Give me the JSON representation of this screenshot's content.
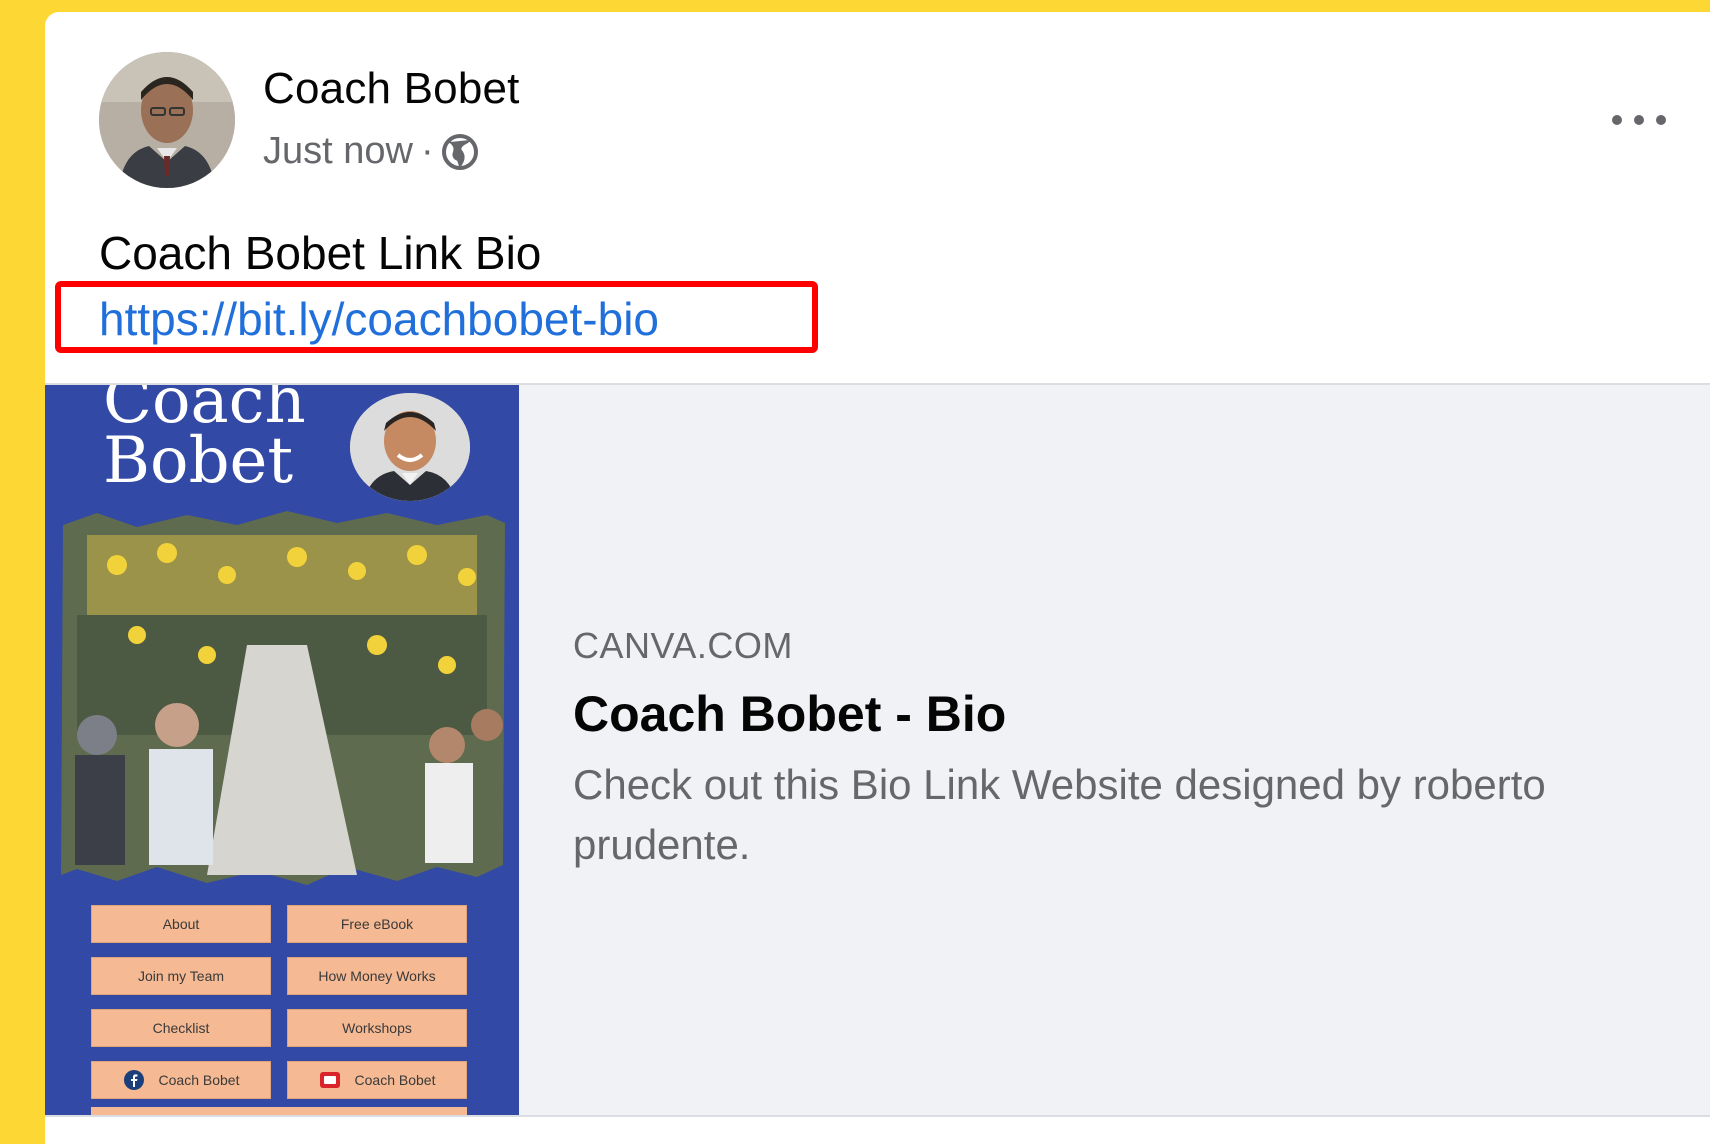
{
  "colors": {
    "page_background": "#fdd835",
    "link": "#216fdb",
    "highlight": "#ff0000",
    "preview_background": "#f0f2f5",
    "thumbnail_background": "#3249a5",
    "thumbnail_button": "#f5b993"
  },
  "post": {
    "author": "Coach Bobet",
    "timestamp": "Just now",
    "separator": "·",
    "privacy_icon": "globe-icon",
    "menu_icon": "more-horizontal-icon",
    "text": "Coach Bobet Link Bio",
    "link": "https://bit.ly/coachbobet-bio"
  },
  "preview": {
    "domain": "CANVA.COM",
    "title": "Coach Bobet - Bio",
    "description": "Check out this Bio Link Website designed by roberto prudente.",
    "thumbnail": {
      "title_line1": "Coach",
      "title_line2": "Bobet",
      "buttons": [
        {
          "label": "About"
        },
        {
          "label": "Free eBook"
        },
        {
          "label": "Join my Team"
        },
        {
          "label": "How Money Works"
        },
        {
          "label": "Checklist"
        },
        {
          "label": "Workshops"
        },
        {
          "label": "Coach Bobet",
          "icon": "facebook-icon"
        },
        {
          "label": "Coach Bobet",
          "icon": "youtube-icon"
        }
      ]
    }
  }
}
